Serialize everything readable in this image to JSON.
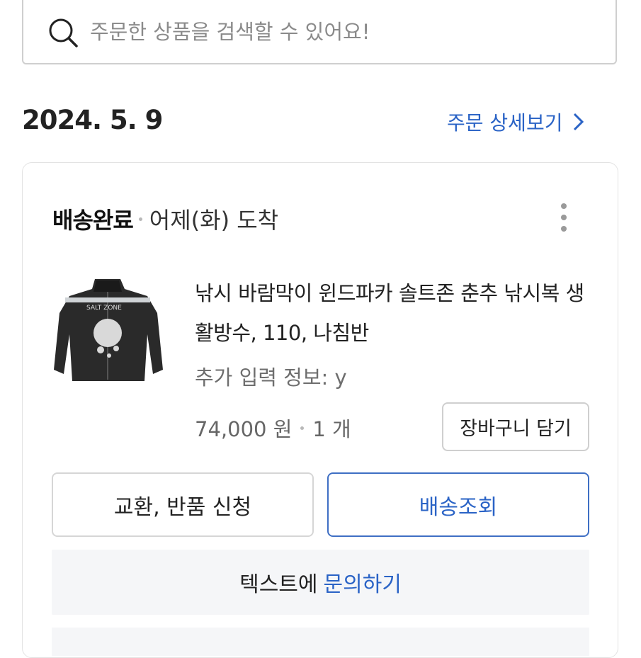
{
  "search": {
    "placeholder": "주문한 상품을 검색할 수 있어요!",
    "value": "",
    "icon": "search-icon"
  },
  "order": {
    "date": "2024. 5. 9",
    "detail_link": "주문 상세보기",
    "detail_icon": "chevron-right-icon",
    "link_color": "#2a63c6"
  },
  "delivery": {
    "status": "배송완료",
    "arrival": "어제(화) 도착",
    "more_icon": "more-vertical-icon"
  },
  "product": {
    "name": "낚시 바람막이 윈드파카 솔트존 춘추 낚시복 생활방수, 110, 나침반",
    "extra_info": "추가 입력 정보: y",
    "price": "74,000 원",
    "quantity": "1 개",
    "cart_button": "장바구니 담기",
    "thumbnail_icon": "jacket-image"
  },
  "actions": {
    "exchange_return": "교환, 반품 신청",
    "tracking": "배송조회",
    "inquiry_prefix": "텍스트에",
    "inquiry_link": "문의하기"
  }
}
